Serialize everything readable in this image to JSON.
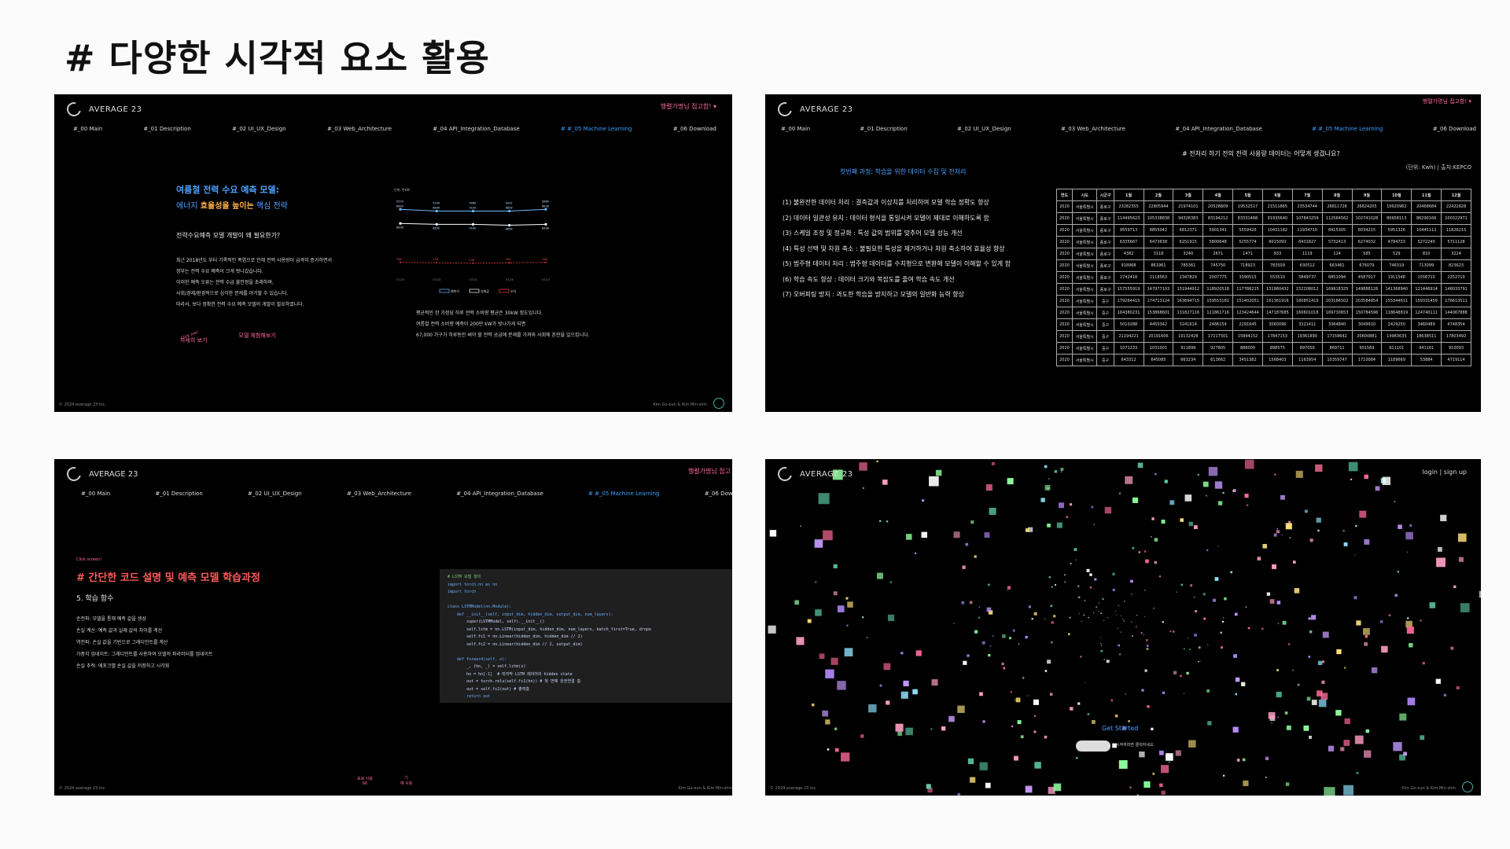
{
  "slide_title": "# 다양한 시각적 요소 활용",
  "brand": "AVERAGE 23",
  "nav": [
    "#_00 Main",
    "#_01 Description",
    "#_02 UI_UX_Design",
    "#_03 Web_Architecture",
    "#_04 API_Integration_Database",
    "#_05 Machine Learning",
    "#_06 Download"
  ],
  "user_corner": "행렬가명님 접고함!",
  "footer_left": "© 2024 average 23 Inc.",
  "footer_right": "Kim Go-eun & Kim Min-shin",
  "panel1": {
    "heading1": "여름철 전력 수요 예측 모델:",
    "heading2_prefix": "에너지",
    "heading2_highlight": "효율성을 높이는",
    "heading2_suffix": "핵심 전략",
    "question": "전력수요예측 모델 개발이 왜 필요한가?",
    "paragraph": [
      "최근 2018년도 부터 기록적인 폭염으로 인해 전력 사용량이 급격히 증가하면서",
      "정부는 전력 수요 예측이 크게 벗나갔습니다.",
      "이러한 예측 오류는 전력 수급 불안정을 초래하며,",
      "사회/경제/환경적으로 심각한 문제를 야기할 수 있습니다.",
      "따라서, 보다 정확한 전력 수요 예측 모델의 개발이 필요하였니다."
    ],
    "link_small": "Click me!",
    "link1": "자세히 보기",
    "link2": "모델 체험해보기",
    "note": [
      "평균적인 한 가정당 하루 전력 소비량 평균은 30kW 정도입니다.",
      "여름철 전력 소비량 예측이 200만 kW가 빗나가게 되면",
      "67,000 가구가 하루동안 써야 할 전력 공급에 문제를 가져와 사회에 혼란을 일으킵니다."
    ]
  },
  "chart_data": {
    "type": "line",
    "title": "단위: 만kW",
    "categories": [
      "07/23",
      "07/24",
      "07/25",
      "07/26",
      "07/27"
    ],
    "series": [
      {
        "name": "예측치",
        "values": [
          8900,
          8890,
          8890,
          8890,
          8900
        ],
        "labels": [
          "8890",
          "8890",
          "9190",
          "8858",
          "8838"
        ],
        "color": "#6fb7ff"
      },
      {
        "name": "실제값",
        "values": [
          8820,
          8815,
          8815,
          8810,
          8815
        ],
        "labels": [
          "8838",
          "8830",
          "9190",
          "8858",
          "8838"
        ],
        "color": "#ffffff"
      },
      {
        "name": "오차",
        "values": [
          8600,
          8598,
          8595,
          8598,
          8600
        ],
        "labels": [
          "100",
          "118",
          "140",
          "105",
          "128"
        ],
        "color": "#ff4040"
      }
    ],
    "top_labels": [
      "5570",
      "5240",
      "5060",
      "5002",
      "5660"
    ],
    "ylim": [
      8550,
      8950
    ]
  },
  "panel2": {
    "user_corner": "행렬가명님 접고함!",
    "caption": "# 전처리 하기 전의 전력 사용량 데이터는 어떻게 생겼나요?",
    "unit": "(단위: Kwh) | 출처:KEPCO",
    "subhead": "첫번째 과정: 학습을 위한 데이터 수집 및 전처리",
    "steps": [
      "(1) 불완전한 데이터 처리 : 결측값과 이상치를 처리하여 모델 학습 정확도 향상",
      "(2) 데이터 일관성 유지 : 데이터 형식을 통일시켜 모델이 제대로 이해하도록 함",
      "(3) 스케일 조정 및 정규화 : 특성 값의 범위를 맞추어 모델 성능 개선",
      "(4) 특성 선택 및 차원 축소 : 불필요한 특성을 제거하거나 차원 축소하여 효율성 향상",
      "(5) 범주형 데이터 처리 : 범주형 데이터를 수치형으로 변환해 모델이 이해할 수 있게 함",
      "(6) 학습 속도 향상 : 데이터 크기와 복잡도를 줄여 학습 속도 개선",
      "(7) 오버피팅 방지 : 과도한 학습을 방지하고 모델의 일반화 능력 향상"
    ],
    "table_header": [
      "연도",
      "시도",
      "시군구",
      "1월",
      "2월",
      "3월",
      "4월",
      "5월",
      "6월",
      "7월",
      "8월",
      "9월",
      "10월",
      "11월",
      "12월"
    ],
    "table_rows": [
      [
        "2020",
        "서울특별시",
        "종로구",
        "23282355",
        "22805944",
        "21974101",
        "20528809",
        "19532517",
        "21511865",
        "23534744",
        "26811726",
        "26624205",
        "19920962",
        "20468684",
        "22422828"
      ],
      [
        "2020",
        "서울특별시",
        "종로구",
        "114495623",
        "105338838",
        "94326383",
        "83194212",
        "83331468",
        "91935640",
        "107843259",
        "112564562",
        "102741028",
        "80658113",
        "86290166",
        "100322971"
      ],
      [
        "2020",
        "서울특별시",
        "종로구",
        "9559713",
        "8855042",
        "6812371",
        "5901341",
        "5559426",
        "10431182",
        "11934710",
        "8415305",
        "8034215",
        "5951326",
        "10445112",
        "11826215"
      ],
      [
        "2020",
        "서울특별시",
        "종로구",
        "6335667",
        "6473638",
        "6251915",
        "5800648",
        "5255774",
        "6015093",
        "6431827",
        "5732413",
        "6274032",
        "4784733",
        "5272240",
        "5711128"
      ],
      [
        "2020",
        "서울특별시",
        "종로구",
        "4382",
        "3118",
        "3240",
        "2671",
        "1471",
        "933",
        "1119",
        "124",
        "585",
        "529",
        "810",
        "3224"
      ],
      [
        "2020",
        "서울특별시",
        "종로구",
        "918968",
        "861961",
        "785361",
        "745750",
        "718923",
        "783509",
        "630512",
        "663461",
        "676079",
        "746319",
        "713099",
        "823623"
      ],
      [
        "2020",
        "서울특별시",
        "종로구",
        "2742418",
        "2118563",
        "2347829",
        "2007775",
        "3390515",
        "553510",
        "5849737",
        "6851094",
        "4587917",
        "1911548",
        "1556710",
        "2252719"
      ],
      [
        "2020",
        "서울특별시",
        "종로구",
        "157555919",
        "147977103",
        "131944912",
        "118920518",
        "117786215",
        "131980432",
        "152208012",
        "169918325",
        "149888126",
        "141368940",
        "121446914",
        "146033791"
      ],
      [
        "2020",
        "서울특별시",
        "중구",
        "179264415",
        "174713124",
        "163694715",
        "159553181",
        "151402051",
        "161361916",
        "180851419",
        "203186502",
        "203584854",
        "155344611",
        "159331459",
        "176613511"
      ],
      [
        "2020",
        "서울특별시",
        "중구",
        "164380231",
        "153868601",
        "131827116",
        "121861716",
        "123424644",
        "147187685",
        "160601018",
        "169730653",
        "150784596",
        "118648819",
        "124740111",
        "144067888"
      ],
      [
        "2020",
        "서울특별시",
        "중구",
        "5010288",
        "4450342",
        "3241614",
        "2486154",
        "2291645",
        "3060096",
        "3321411",
        "3364840",
        "3049910",
        "2429250",
        "3460489",
        "4748354"
      ],
      [
        "2020",
        "서울특별시",
        "중구",
        "21194221",
        "20191606",
        "19132428",
        "17217501",
        "15844152",
        "17847153",
        "19361890",
        "17158642",
        "20600881",
        "14983635",
        "18638511",
        "17803492"
      ],
      [
        "2020",
        "서울특별시",
        "중구",
        "1071233",
        "1031001",
        "911899",
        "927805",
        "886000",
        "898575",
        "897056",
        "869711",
        "901569",
        "911101",
        "941161",
        "910093"
      ],
      [
        "2020",
        "서울특별시",
        "중구",
        "643312",
        "645085",
        "663234",
        "613662",
        "3451382",
        "1568403",
        "1163954",
        "10359747",
        "1710084",
        "1189669",
        "53884",
        "4719114"
      ]
    ]
  },
  "panel3": {
    "user_corner": "행렬가명님 접고",
    "click": "Click screen!",
    "heading": "# 간단한 코드 설명 및 예측 모델 학습과정",
    "subheading": "5. 학습 함수",
    "lines": [
      "순전파: 모델을 통해 예측 값을 생성",
      "손실 계산: 예측 값과 실제 값의 차이를 계산",
      "역전파: 손실 값을 기반으로 그래디언트를 계산",
      "가중치 업데이트: 그래디언트를 사용하여 모델의 파라미터를 업데이트",
      "손실 추적: 에포크별 손실 값을 저장하고 시각화"
    ],
    "code": [
      "# LSTM 모델 정의",
      "import torch.nn as nn",
      "import torch",
      "",
      "class LSTMModel(nn.Module):",
      "    def __init__(self, input_dim, hidden_dim, output_dim, num_layers):",
      "        super(LSTMModel, self).__init__()",
      "        self.lstm = nn.LSTM(input_dim, hidden_dim, num_layers, batch_first=True, dropo",
      "        self.fc1 = nn.Linear(hidden_dim, hidden_dim // 2)",
      "        self.fc2 = nn.Linear(hidden_dim // 2, output_dim)",
      "",
      "    def forward(self, x):",
      "        _, (hn, _) = self.lstm(x)",
      "        hn = hn[-1]  # 마지막 LSTM 레이어의 hidden state",
      "        out = torch.relu(self.fc1(hn)) # 첫 번째 완전연결 층",
      "        out = self.fc2(out) # 출력층",
      "        return out"
    ],
    "bottom1": "포로 사용\n66",
    "bottom2": "기\n예 사용"
  },
  "panel4": {
    "brand": "AVERAGE 23",
    "login": "login | sign up",
    "get_started": "Get Started",
    "btn_text": "시작하려면 클릭하세요."
  }
}
